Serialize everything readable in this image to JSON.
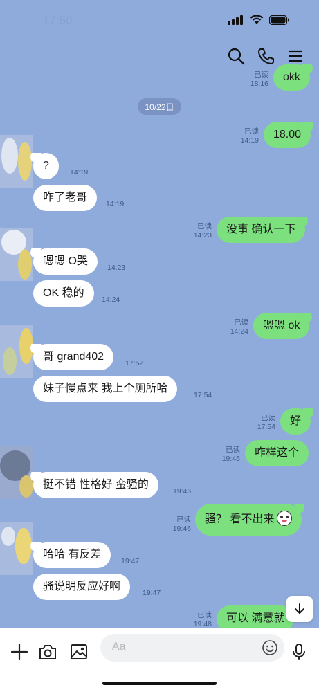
{
  "status_bar": {
    "time": "17:50"
  },
  "header": {
    "icons": [
      "search-icon",
      "phone-icon",
      "menu-icon"
    ]
  },
  "date_separator": "10/22日",
  "messages": [
    {
      "side": "out",
      "text": "okk",
      "read": "已读",
      "time": "18:16"
    },
    {
      "side": "out",
      "text": "18.00",
      "read": "已读",
      "time": "14:19"
    },
    {
      "side": "in",
      "text": "?",
      "time": "14:19"
    },
    {
      "side": "in",
      "text": "咋了老哥",
      "time": "14:19"
    },
    {
      "side": "out",
      "text": "没事 确认一下",
      "read": "已读",
      "time": "14:23"
    },
    {
      "side": "in",
      "text": "嗯嗯 O哭",
      "time": "14:23"
    },
    {
      "side": "in",
      "text": "OK 稳的",
      "time": "14:24"
    },
    {
      "side": "out",
      "text": "嗯嗯 ok",
      "read": "已读",
      "time": "14:24"
    },
    {
      "side": "in",
      "text": "哥 grand402",
      "time": "17:52"
    },
    {
      "side": "in",
      "text": "妹子慢点来 我上个厕所哈",
      "time": "17:54"
    },
    {
      "side": "out",
      "text": "好",
      "read": "已读",
      "time": "17:54"
    },
    {
      "side": "out",
      "text": "咋样这个",
      "read": "已读",
      "time": "19:45"
    },
    {
      "side": "in",
      "text": "挺不错 性格好 蛮骚的",
      "time": "19:46"
    },
    {
      "side": "out",
      "text": "骚？ 看不出来",
      "read": "已读",
      "time": "19:46",
      "emoji": "laughing-emoji-icon"
    },
    {
      "side": "in",
      "text": "哈哈 有反差",
      "time": "19:47"
    },
    {
      "side": "in",
      "text": "骚说明反应好啊",
      "time": "19:47"
    },
    {
      "side": "out",
      "text": "可以 满意就",
      "read": "已读",
      "time": "19:48"
    }
  ],
  "input_bar": {
    "placeholder": "Aa",
    "icons": [
      "plus-icon",
      "camera-icon",
      "image-icon",
      "emoji-icon",
      "microphone-icon"
    ]
  },
  "colors": {
    "chat_background": "#8fabdb",
    "outgoing_bubble": "#7ce07f",
    "incoming_bubble": "#ffffff",
    "date_chip": "#7a93c2"
  }
}
